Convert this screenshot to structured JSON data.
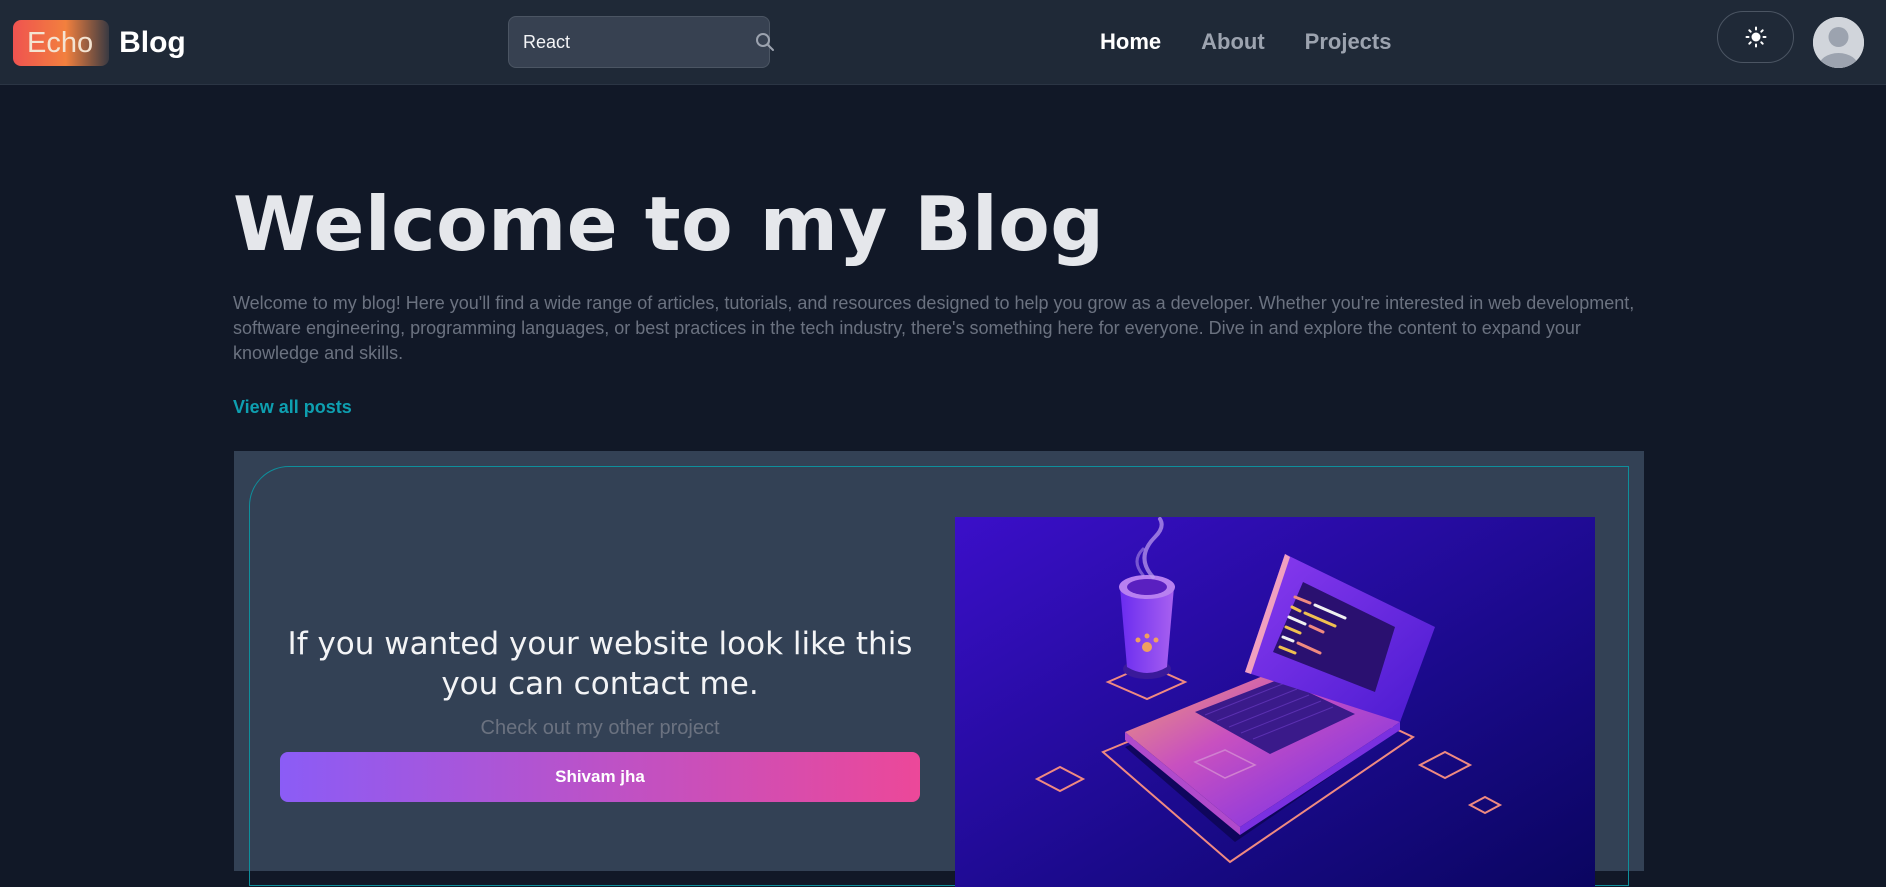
{
  "navbar": {
    "logo_badge": "Echo",
    "logo_text": "Blog",
    "search_value": "React",
    "search_icon": "search-icon",
    "links": [
      {
        "label": "Home",
        "active": true
      },
      {
        "label": "About",
        "active": false
      },
      {
        "label": "Projects",
        "active": false
      }
    ],
    "theme_icon": "sun-icon",
    "avatar_icon": "user-avatar-icon"
  },
  "hero": {
    "title": "Welcome to my Blog",
    "description": "Welcome to my blog! Here you'll find a wide range of articles, tutorials, and resources designed to help you grow as a developer. Whether you're interested in web development, software engineering, programming languages, or best practices in the tech industry, there's something here for everyone. Dive in and explore the content to expand your knowledge and skills.",
    "view_all": "View all posts"
  },
  "cta": {
    "heading": "If you wanted your website look like this you can contact me.",
    "subtext": "Check out my other project",
    "button_label": "Shivam jha"
  },
  "colors": {
    "background": "#111827",
    "navbar": "#1f2937",
    "panel": "#334155",
    "accent_teal": "#0e9fb0",
    "gradient_start": "#8b5cf6",
    "gradient_end": "#ec4899"
  }
}
